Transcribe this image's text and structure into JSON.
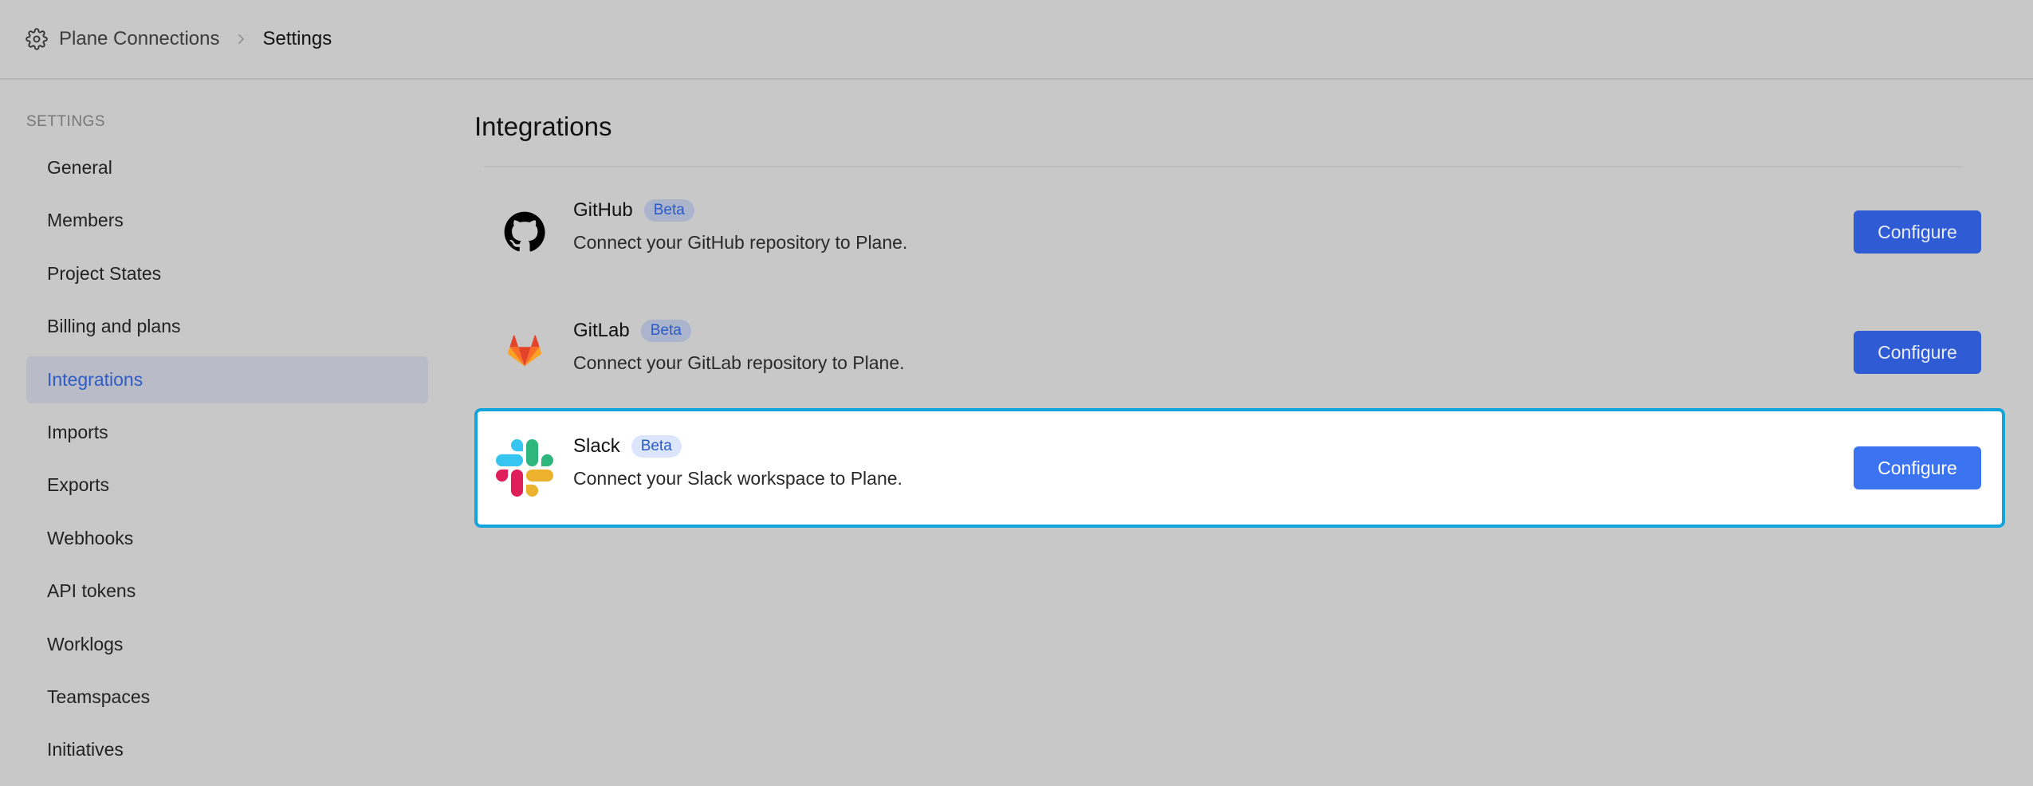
{
  "breadcrumb": {
    "root": "Plane Connections",
    "current": "Settings"
  },
  "sidebar": {
    "heading": "SETTINGS",
    "items": [
      {
        "label": "General"
      },
      {
        "label": "Members"
      },
      {
        "label": "Project States"
      },
      {
        "label": "Billing and plans"
      },
      {
        "label": "Integrations",
        "active": true
      },
      {
        "label": "Imports"
      },
      {
        "label": "Exports"
      },
      {
        "label": "Webhooks"
      },
      {
        "label": "API tokens"
      },
      {
        "label": "Worklogs"
      },
      {
        "label": "Teamspaces"
      },
      {
        "label": "Initiatives"
      }
    ]
  },
  "main": {
    "title": "Integrations",
    "integrations": [
      {
        "name": "GitHub",
        "badge": "Beta",
        "description": "Connect your GitHub repository to Plane.",
        "button": "Configure",
        "icon": "github-icon"
      },
      {
        "name": "GitLab",
        "badge": "Beta",
        "description": "Connect your GitLab repository to Plane.",
        "button": "Configure",
        "icon": "gitlab-icon"
      },
      {
        "name": "Slack",
        "badge": "Beta",
        "description": "Connect your Slack workspace to Plane.",
        "button": "Configure",
        "icon": "slack-icon",
        "highlighted": true
      }
    ]
  },
  "colors": {
    "background": "#c8c8c8",
    "accent": "#2f5bd4",
    "highlight_border": "#14a4dc",
    "active_nav_text": "#2f5cc6"
  }
}
